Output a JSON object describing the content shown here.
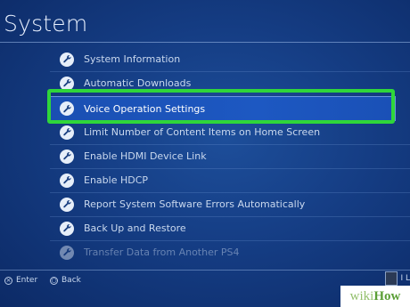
{
  "header": {
    "title": "System"
  },
  "menu": {
    "items": [
      {
        "label": "System Information",
        "icon": "wrench-icon"
      },
      {
        "label": "Automatic Downloads",
        "icon": "wrench-icon"
      },
      {
        "label": "Voice Operation Settings",
        "icon": "wrench-icon",
        "selected": true
      },
      {
        "label": "Limit Number of Content Items on Home Screen",
        "icon": "wrench-icon"
      },
      {
        "label": "Enable HDMI Device Link",
        "icon": "wrench-icon"
      },
      {
        "label": "Enable HDCP",
        "icon": "wrench-icon"
      },
      {
        "label": "Report System Software Errors Automatically",
        "icon": "wrench-icon"
      },
      {
        "label": "Back Up and Restore",
        "icon": "wrench-icon"
      },
      {
        "label": "Transfer Data from Another PS4",
        "icon": "wrench-icon"
      }
    ]
  },
  "footer": {
    "enter_label": "Enter",
    "back_label": "Back",
    "corner_text": "I L"
  },
  "watermark": {
    "wiki": "wiki",
    "how": "How"
  },
  "colors": {
    "background": "#153d84",
    "selection": "#1d58c2",
    "highlight_outline": "#2fd63a"
  }
}
